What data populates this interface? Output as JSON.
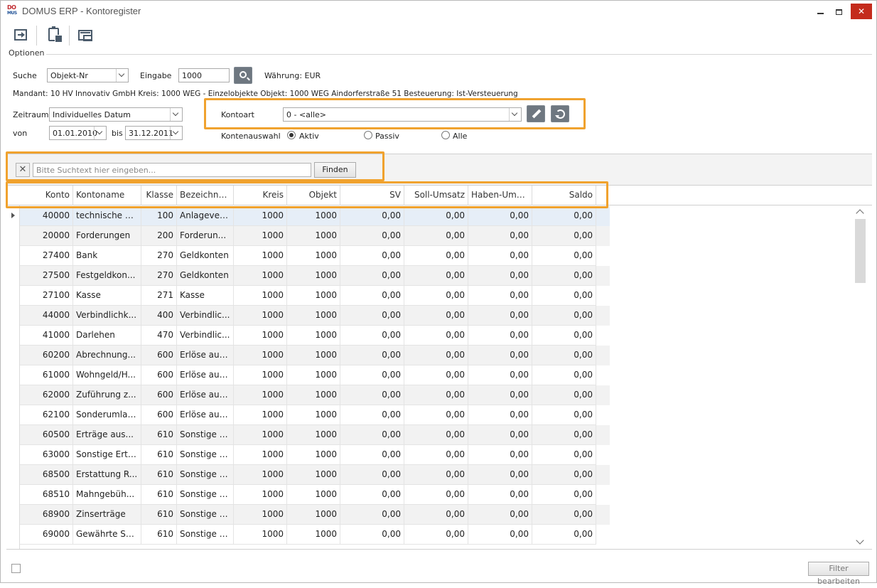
{
  "window": {
    "logo_top": "DO",
    "logo_bottom": "MUS",
    "title": "DOMUS ERP - Kontoregister",
    "close_glyph": "✕"
  },
  "toolbar": {
    "icons": [
      "exit-icon",
      "clipboard-calculator-icon",
      "screen-icon"
    ]
  },
  "options": {
    "legend": "Optionen",
    "suche_label": "Suche",
    "suche_value": "Objekt-Nr",
    "eingabe_label": "Eingabe",
    "eingabe_value": "1000",
    "waehrung": "Währung: EUR",
    "info_line": "Mandant: 10 HV Innovativ GmbH  Kreis: 1000 WEG - Einzelobjekte  Objekt: 1000 WEG Aindorferstraße 51  Besteuerung: Ist-Versteuerung",
    "zeitraum_label": "Zeitraum",
    "zeitraum_value": "Individuelles Datum",
    "von_label": "von",
    "von_value": "01.01.2010",
    "bis_label": "bis",
    "bis_value": "31.12.2011",
    "kontoart_label": "Kontoart",
    "kontoart_value": "0 - <alle>",
    "kontenauswahl_label": "Kontenauswahl",
    "radio_aktiv": "Aktiv",
    "radio_passiv": "Passiv",
    "radio_alle": "Alle",
    "selected_radio": "Aktiv"
  },
  "search": {
    "clear_glyph": "✕",
    "placeholder": "Bitte Suchtext hier eingeben...",
    "find_label": "Finden"
  },
  "grid": {
    "columns": [
      "Konto",
      "Kontoname",
      "Klasse",
      "Bezeichnu...",
      "Kreis",
      "Objekt",
      "SV",
      "Soll-Umsatz",
      "Haben-Ums...",
      "Saldo"
    ],
    "rows": [
      [
        "40000",
        "technische A...",
        "100",
        "Anlagever...",
        "1000",
        "1000",
        "0,00",
        "0,00",
        "0,00",
        "0,00"
      ],
      [
        "20000",
        "Forderungen",
        "200",
        "Forderun...",
        "1000",
        "1000",
        "0,00",
        "0,00",
        "0,00",
        "0,00"
      ],
      [
        "27400",
        "Bank",
        "270",
        "Geldkonten",
        "1000",
        "1000",
        "0,00",
        "0,00",
        "0,00",
        "0,00"
      ],
      [
        "27500",
        "Festgeldkon...",
        "270",
        "Geldkonten",
        "1000",
        "1000",
        "0,00",
        "0,00",
        "0,00",
        "0,00"
      ],
      [
        "27100",
        "Kasse",
        "271",
        "Kasse",
        "1000",
        "1000",
        "0,00",
        "0,00",
        "0,00",
        "0,00"
      ],
      [
        "44000",
        "Verbindlichk...",
        "400",
        "Verbindlic...",
        "1000",
        "1000",
        "0,00",
        "0,00",
        "0,00",
        "0,00"
      ],
      [
        "41000",
        "Darlehen",
        "470",
        "Verbindlic...",
        "1000",
        "1000",
        "0,00",
        "0,00",
        "0,00",
        "0,00"
      ],
      [
        "60200",
        "Abrechnung...",
        "600",
        "Erlöse aus...",
        "1000",
        "1000",
        "0,00",
        "0,00",
        "0,00",
        "0,00"
      ],
      [
        "61000",
        "Wohngeld/H...",
        "600",
        "Erlöse aus...",
        "1000",
        "1000",
        "0,00",
        "0,00",
        "0,00",
        "0,00"
      ],
      [
        "62000",
        "Zuführung z...",
        "600",
        "Erlöse aus...",
        "1000",
        "1000",
        "0,00",
        "0,00",
        "0,00",
        "0,00"
      ],
      [
        "62100",
        "Sonderumlage",
        "600",
        "Erlöse aus...",
        "1000",
        "1000",
        "0,00",
        "0,00",
        "0,00",
        "0,00"
      ],
      [
        "60500",
        "Erträge aus...",
        "610",
        "Sonstige E...",
        "1000",
        "1000",
        "0,00",
        "0,00",
        "0,00",
        "0,00"
      ],
      [
        "63000",
        "Sonstige Ertr...",
        "610",
        "Sonstige E...",
        "1000",
        "1000",
        "0,00",
        "0,00",
        "0,00",
        "0,00"
      ],
      [
        "68500",
        "Erstattung R...",
        "610",
        "Sonstige E...",
        "1000",
        "1000",
        "0,00",
        "0,00",
        "0,00",
        "0,00"
      ],
      [
        "68510",
        "Mahngebüh...",
        "610",
        "Sonstige E...",
        "1000",
        "1000",
        "0,00",
        "0,00",
        "0,00",
        "0,00"
      ],
      [
        "68900",
        "Zinserträge",
        "610",
        "Sonstige E...",
        "1000",
        "1000",
        "0,00",
        "0,00",
        "0,00",
        "0,00"
      ],
      [
        "69000",
        "Gewährte Sk...",
        "610",
        "Sonstige E...",
        "1000",
        "1000",
        "0,00",
        "0,00",
        "0,00",
        "0,00"
      ]
    ]
  },
  "footer": {
    "filter_label": "Filter bearbeiten"
  },
  "colors": {
    "highlight": "#f0a22e",
    "selected_row": "#e6eef7",
    "alt_row": "#f2f2f2",
    "close_button": "#c42b1c"
  }
}
